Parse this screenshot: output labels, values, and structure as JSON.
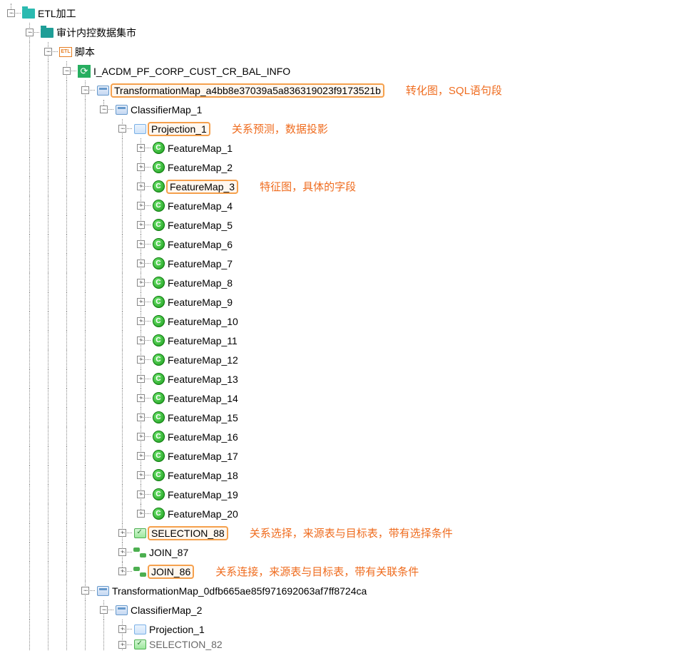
{
  "root": "ETL加工",
  "l1": "审计内控数据集市",
  "l2": "脚本",
  "l3": "I_ACDM_PF_CORP_CUST_CR_BAL_INFO",
  "tmap1": "TransformationMap_a4bb8e37039a5a836319023f9173521b",
  "cmap1": "ClassifierMap_1",
  "proj1": "Projection_1",
  "feats": [
    "FeatureMap_1",
    "FeatureMap_2",
    "FeatureMap_3",
    "FeatureMap_4",
    "FeatureMap_5",
    "FeatureMap_6",
    "FeatureMap_7",
    "FeatureMap_8",
    "FeatureMap_9",
    "FeatureMap_10",
    "FeatureMap_11",
    "FeatureMap_12",
    "FeatureMap_13",
    "FeatureMap_14",
    "FeatureMap_15",
    "FeatureMap_16",
    "FeatureMap_17",
    "FeatureMap_18",
    "FeatureMap_19",
    "FeatureMap_20"
  ],
  "sel88": "SELECTION_88",
  "join87": "JOIN_87",
  "join86": "JOIN_86",
  "tmap2": "TransformationMap_0dfb665ae85f971692063af7ff8724ca",
  "cmap2": "ClassifierMap_2",
  "proj2": "Projection_1",
  "sel82": "SELECTION_82",
  "etl_icon_text": "ETL",
  "ann": {
    "tmap": "转化图，SQL语句段",
    "proj": "关系预测，数据投影",
    "feat": "特征图，具体的字段",
    "sel": "关系选择，来源表与目标表，带有选择条件",
    "join": "关系连接，来源表与目标表，带有关联条件"
  }
}
